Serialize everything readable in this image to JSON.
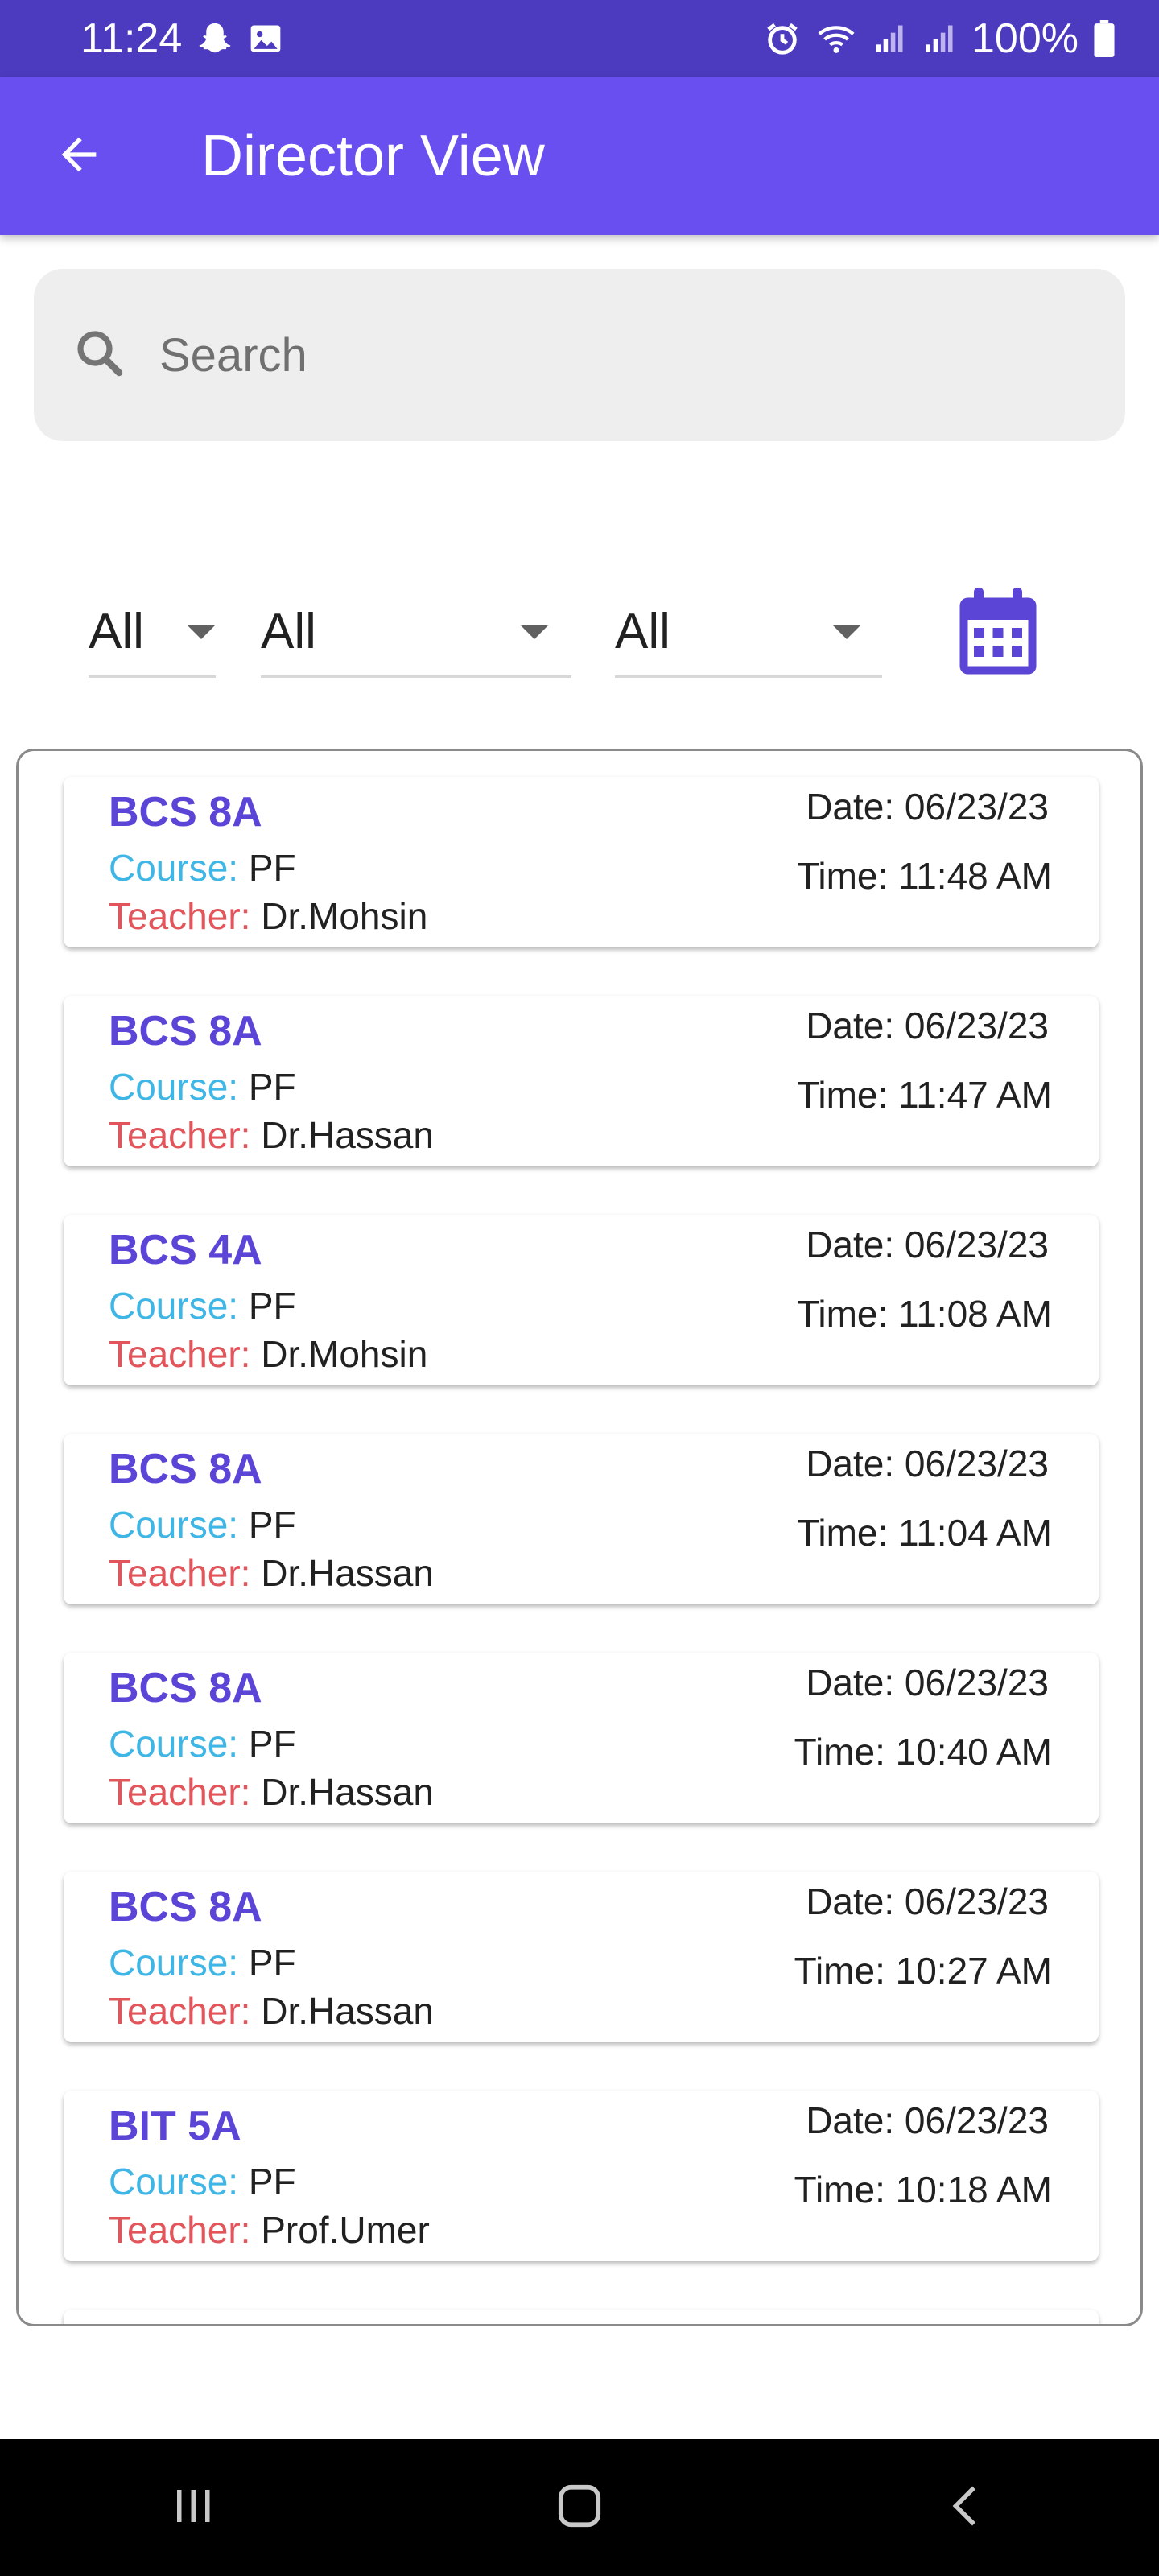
{
  "status_bar": {
    "time": "11:24",
    "battery": "100%"
  },
  "app_bar": {
    "title": "Director View"
  },
  "search": {
    "placeholder": "Search"
  },
  "filters": [
    {
      "value": "All"
    },
    {
      "value": "All"
    },
    {
      "value": "All"
    }
  ],
  "labels": {
    "course": "Course:",
    "teacher": "Teacher:"
  },
  "records": [
    {
      "class": "BCS 8A",
      "course": "PF",
      "teacher": "Dr.Mohsin",
      "date": "Date: 06/23/23",
      "time": "Time: 11:48 AM"
    },
    {
      "class": "BCS 8A",
      "course": "PF",
      "teacher": "Dr.Hassan",
      "date": "Date: 06/23/23",
      "time": "Time: 11:47 AM"
    },
    {
      "class": "BCS 4A",
      "course": "PF",
      "teacher": "Dr.Mohsin",
      "date": "Date: 06/23/23",
      "time": "Time: 11:08 AM"
    },
    {
      "class": "BCS 8A",
      "course": "PF",
      "teacher": "Dr.Hassan",
      "date": "Date: 06/23/23",
      "time": "Time: 11:04 AM"
    },
    {
      "class": "BCS 8A",
      "course": "PF",
      "teacher": "Dr.Hassan",
      "date": "Date: 06/23/23",
      "time": "Time: 10:40 AM"
    },
    {
      "class": "BCS 8A",
      "course": "PF",
      "teacher": "Dr.Hassan",
      "date": "Date: 06/23/23",
      "time": "Time: 10:27 AM"
    },
    {
      "class": "BIT 5A",
      "course": "PF",
      "teacher": "Prof.Umer",
      "date": "Date: 06/23/23",
      "time": "Time: 10:18 AM"
    }
  ],
  "colors": {
    "status_bar": "#4d3bbf",
    "app_bar": "#6a4ff0",
    "class_label": "#5a45d6",
    "course_label": "#3fb6e6",
    "teacher_label": "#e2555a"
  },
  "icons": {
    "status_left": [
      "snapchat-icon",
      "gallery-icon"
    ],
    "status_right": [
      "alarm-icon",
      "wifi-icon",
      "signal-icon",
      "signal-icon",
      "battery-icon"
    ],
    "app_bar": "back-arrow-icon",
    "search": "search-icon",
    "filter": "calendar-icon",
    "nav": [
      "recents-icon",
      "home-icon",
      "back-icon"
    ]
  }
}
